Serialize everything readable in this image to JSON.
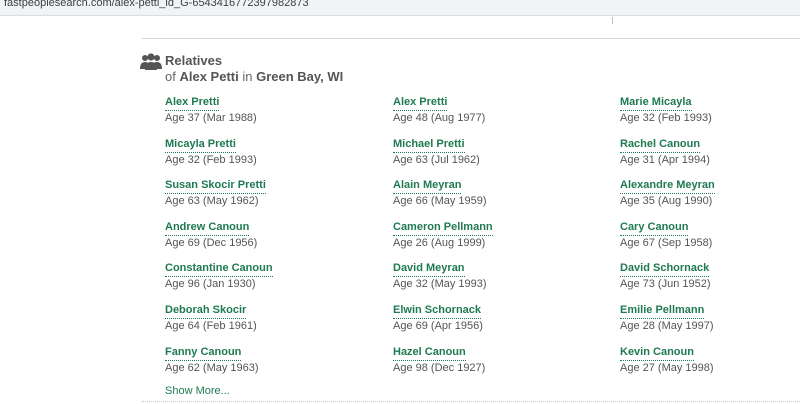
{
  "browser": {
    "url": "fastpeoplesearch.com/alex-petti_id_G-6543416772397982873"
  },
  "relatives": {
    "heading": "Relatives",
    "of_word": "of",
    "person": "Alex Petti",
    "in_word": "in",
    "location": "Green Bay, WI",
    "show_more": "Show More...",
    "columns": [
      [
        {
          "name": "Alex Pretti",
          "age": "Age 37 (Mar 1988)"
        },
        {
          "name": "Micayla Pretti",
          "age": "Age 32 (Feb 1993)"
        },
        {
          "name": "Susan Skocir Pretti",
          "age": "Age 63 (May 1962)"
        },
        {
          "name": "Andrew Canoun",
          "age": "Age 69 (Dec 1956)"
        },
        {
          "name": "Constantine Canoun",
          "age": "Age 96 (Jan 1930)"
        },
        {
          "name": "Deborah Skocir",
          "age": "Age 64 (Feb 1961)"
        },
        {
          "name": "Fanny Canoun",
          "age": "Age 62 (May 1963)"
        }
      ],
      [
        {
          "name": "Alex Pretti",
          "age": "Age 48 (Aug 1977)"
        },
        {
          "name": "Michael Pretti",
          "age": "Age 63 (Jul 1962)"
        },
        {
          "name": "Alain Meyran",
          "age": "Age 66 (May 1959)"
        },
        {
          "name": "Cameron Pellmann",
          "age": "Age 26 (Aug 1999)"
        },
        {
          "name": "David Meyran",
          "age": "Age 32 (May 1993)"
        },
        {
          "name": "Elwin Schornack",
          "age": "Age 69 (Apr 1956)"
        },
        {
          "name": "Hazel Canoun",
          "age": "Age 98 (Dec 1927)"
        }
      ],
      [
        {
          "name": "Marie Micayla",
          "age": "Age 32 (Feb 1993)"
        },
        {
          "name": "Rachel Canoun",
          "age": "Age 31 (Apr 1994)"
        },
        {
          "name": "Alexandre Meyran",
          "age": "Age 35 (Aug 1990)"
        },
        {
          "name": "Cary Canoun",
          "age": "Age 67 (Sep 1958)"
        },
        {
          "name": "David Schornack",
          "age": "Age 73 (Jun 1952)"
        },
        {
          "name": "Emilie Pellmann",
          "age": "Age 28 (May 1997)"
        },
        {
          "name": "Kevin Canoun",
          "age": "Age 27 (May 1998)"
        }
      ]
    ]
  },
  "colors": {
    "link": "#1f7a52",
    "text": "#555555"
  },
  "icons": {
    "relatives": "group-icon"
  }
}
